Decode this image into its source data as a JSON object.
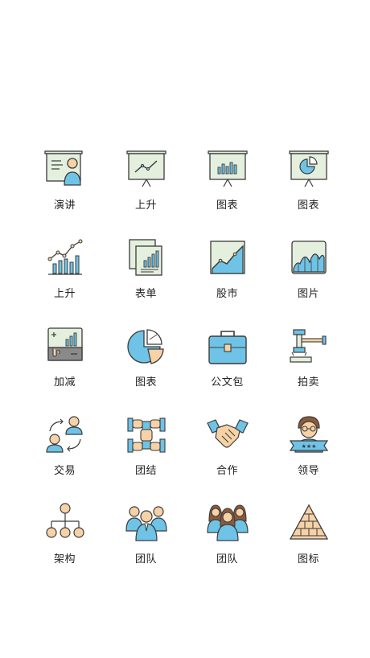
{
  "palette": {
    "outline": "#3b3b3b",
    "green": "#e4efdd",
    "blue": "#6fc3e6",
    "skin": "#f6d2a6",
    "grey": "#8a8a8a"
  },
  "icons": [
    {
      "label": "演讲",
      "icon": "presentation-speaker-icon"
    },
    {
      "label": "上升",
      "icon": "presentation-rise-icon"
    },
    {
      "label": "图表",
      "icon": "presentation-bar-icon"
    },
    {
      "label": "图表",
      "icon": "presentation-pie-icon"
    },
    {
      "label": "上升",
      "icon": "line-bar-rise-icon"
    },
    {
      "label": "表单",
      "icon": "report-sheets-icon"
    },
    {
      "label": "股市",
      "icon": "stock-chart-icon"
    },
    {
      "label": "图片",
      "icon": "area-chart-icon"
    },
    {
      "label": "加减",
      "icon": "plus-minus-board-icon"
    },
    {
      "label": "图表",
      "icon": "pie-chart-icon"
    },
    {
      "label": "公文包",
      "icon": "briefcase-icon"
    },
    {
      "label": "拍卖",
      "icon": "auction-gavel-icon"
    },
    {
      "label": "交易",
      "icon": "exchange-people-icon"
    },
    {
      "label": "团结",
      "icon": "hands-unity-icon"
    },
    {
      "label": "合作",
      "icon": "handshake-icon"
    },
    {
      "label": "领导",
      "icon": "leader-icon"
    },
    {
      "label": "架构",
      "icon": "org-structure-icon"
    },
    {
      "label": "团队",
      "icon": "team-men-icon"
    },
    {
      "label": "团队",
      "icon": "team-women-icon"
    },
    {
      "label": "图标",
      "icon": "pyramid-icon"
    }
  ]
}
